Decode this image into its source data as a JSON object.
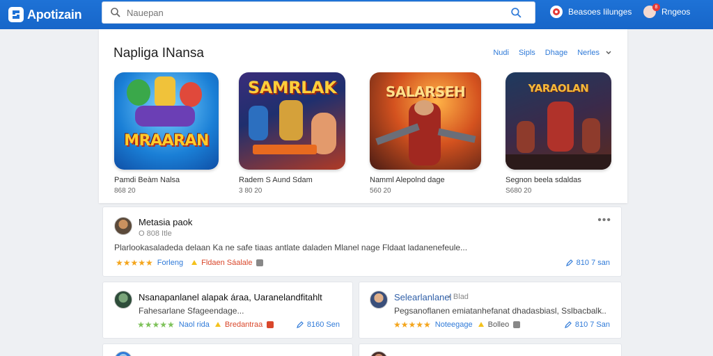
{
  "app": {
    "title": "Apotizain"
  },
  "search": {
    "placeholder": "Nauepan"
  },
  "header": {
    "action1": {
      "label": "Beasoes Iilunges"
    },
    "action2": {
      "label": "Rngeos",
      "badge": "8"
    }
  },
  "featured": {
    "title": "Napliga INansa",
    "filters": [
      "Nudi",
      "Sipls",
      "Dhage",
      "Nerles"
    ],
    "apps": [
      {
        "name": "Pamdi Beàm Nalsa",
        "meta": "868 20",
        "banner": "MRAARAN"
      },
      {
        "name": "Radem S Aund Sdam",
        "meta": "3 80 20",
        "banner": "SAMRLAK"
      },
      {
        "name": "Namml Alepolnd dage",
        "meta": "560 20",
        "banner": "SALARSEH"
      },
      {
        "name": "Segnon beela sdaldas",
        "meta": "S680 20",
        "banner": "YARAOLAN"
      }
    ]
  },
  "posts": [
    {
      "title": "Metasia paok",
      "sub": "O 808 Itle",
      "body": "Plarlookasaladeda delaan Ka ne safe tiaas antlate daladen Mlanel nage Fldaat ladanenefeule...",
      "stars": "★★★★★",
      "tag1": "Forleng",
      "tag2": "Fldaen Sáalale",
      "right": "810 7 san",
      "more": "•••"
    },
    {
      "title": "Nsanapanlanel alapak áraa, Uaranelandfitahlt",
      "body": "Fahesarlane Sfageendage...",
      "stars": "★★★★★",
      "tag1": "Naol rida",
      "tag2": "Bredantraa",
      "right": "8160 Sen"
    },
    {
      "title": "Selearlanlanel",
      "sub": "• Blad",
      "body": "Pegsanoflanen emiatanhefanat dhadasbiasl, Sslbacbalk..",
      "stars": "★★★★★",
      "tag1": "Noteegage",
      "tag2": "Bolleo",
      "right": "810 7 San"
    }
  ],
  "colors": {
    "brand": "#1e72d6",
    "link": "#2f7ad8",
    "star": "#f4a51c"
  }
}
